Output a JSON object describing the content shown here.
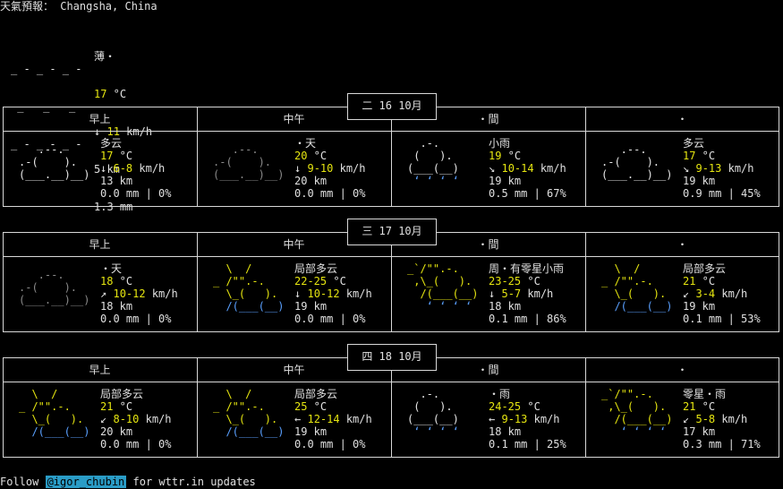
{
  "header": {
    "title": "天氣預報： Changsha, China"
  },
  "current": {
    "condition": "薄・",
    "temp": "17",
    "temp_unit": " °C",
    "wind_arrow": "↓",
    "wind_speed": "11",
    "wind_unit": " km/h",
    "visibility": "5 km",
    "precip": "1.3 mm",
    "art": [
      "_ - _ - _ -",
      " _ - _ - _",
      "_ - _ - _ -"
    ]
  },
  "days": [
    {
      "date": "二 16 10月",
      "periods": [
        {
          "title": "早上",
          "icon": "cloudy-icon",
          "icon_style": "art",
          "art": [
            "   .--.",
            ".-(    ).",
            "(___.__)__)"
          ],
          "condition": "多云",
          "temp": "17",
          "wind_arrow": "↓",
          "wind": "6-8",
          "visibility": "13 km",
          "precip": "0.0 mm | 0%"
        },
        {
          "title": "中午",
          "icon": "clear-icon",
          "icon_style": "gray",
          "art": [
            "   .--.",
            ".-(    ).",
            "(___.__)__)"
          ],
          "condition": "・天",
          "temp": "20",
          "wind_arrow": "↓",
          "wind": "9-10",
          "visibility": "20 km",
          "precip": "0.0 mm | 0%"
        },
        {
          "title": "・間",
          "icon": "light-rain-icon",
          "icon_style": "art",
          "art": [
            "  .-.",
            " (   ).",
            "(___(__)",
            " ‘ ‘ ‘ ‘"
          ],
          "condition": "小雨",
          "temp": "19",
          "wind_arrow": "↘",
          "wind": "10-14",
          "visibility": "19 km",
          "precip": "0.5 mm | 67%"
        },
        {
          "title": "・",
          "icon": "cloudy-icon",
          "icon_style": "art",
          "art": [
            "   .--.",
            ".-(    ).",
            "(___.__)__)"
          ],
          "condition": "多云",
          "temp": "17",
          "wind_arrow": "↘",
          "wind": "9-13",
          "visibility": "19 km",
          "precip": "0.9 mm | 45%"
        }
      ]
    },
    {
      "date": "三 17 10月",
      "periods": [
        {
          "title": "早上",
          "icon": "clear-icon",
          "icon_style": "gray",
          "art": [
            "   .--.",
            ".-(    ).",
            "(___.__)__)"
          ],
          "condition": "・天",
          "temp": "18",
          "wind_arrow": "↗",
          "wind": "10-12",
          "visibility": "18 km",
          "precip": "0.0 mm | 0%"
        },
        {
          "title": "中午",
          "icon": "partly-cloudy-icon",
          "icon_style": "sun",
          "art": [
            "  \\  /",
            "_ /\"\".-.",
            "  \\_(   ).",
            "  /(___(__)"
          ],
          "condition": "局部多云",
          "temp": "22-25",
          "wind_arrow": "↓",
          "wind": "10-12",
          "visibility": "19 km",
          "precip": "0.0 mm | 0%"
        },
        {
          "title": "・間",
          "icon": "patchy-rain-icon",
          "icon_style": "sun",
          "art": [
            "_`/\"\".-.",
            " ,\\_(   ).",
            "  /(___(__)",
            "   ‘ ‘ ‘ ‘"
          ],
          "condition": "周・有零星小雨",
          "temp": "23-25",
          "wind_arrow": "↓",
          "wind": "5-7",
          "visibility": "18 km",
          "precip": "0.1 mm | 86%"
        },
        {
          "title": "・",
          "icon": "partly-cloudy-icon",
          "icon_style": "sun",
          "art": [
            "  \\  /",
            "_ /\"\".-.",
            "  \\_(   ).",
            "  /(___(__)"
          ],
          "condition": "局部多云",
          "temp": "21",
          "wind_arrow": "↙",
          "wind": "3-4",
          "visibility": "19 km",
          "precip": "0.1 mm | 53%"
        }
      ]
    },
    {
      "date": "四 18 10月",
      "periods": [
        {
          "title": "早上",
          "icon": "partly-cloudy-icon",
          "icon_style": "sun",
          "art": [
            "  \\  /",
            "_ /\"\".-.",
            "  \\_(   ).",
            "  /(___(__)"
          ],
          "condition": "局部多云",
          "temp": "21",
          "wind_arrow": "↙",
          "wind": "8-10",
          "visibility": "20 km",
          "precip": "0.0 mm | 0%"
        },
        {
          "title": "中午",
          "icon": "partly-cloudy-icon",
          "icon_style": "sun",
          "art": [
            "  \\  /",
            "_ /\"\".-.",
            "  \\_(   ).",
            "  /(___(__)"
          ],
          "condition": "局部多云",
          "temp": "25",
          "wind_arrow": "←",
          "wind": "12-14",
          "visibility": "19 km",
          "precip": "0.0 mm | 0%"
        },
        {
          "title": "・間",
          "icon": "light-rain-icon",
          "icon_style": "art",
          "art": [
            "  .-.",
            " (   ).",
            "(___(__)",
            " ‘ ‘ ‘ ‘"
          ],
          "condition": "・雨",
          "temp": "24-25",
          "wind_arrow": "←",
          "wind": "9-13",
          "visibility": "18 km",
          "precip": "0.1 mm | 25%"
        },
        {
          "title": "・",
          "icon": "patchy-rain-icon",
          "icon_style": "sun",
          "art": [
            "_`/\"\".-.",
            " ,\\_(   ).",
            "  /(___(__)",
            "   ‘ ‘ ‘ ‘"
          ],
          "condition": "零星・雨",
          "temp": "21",
          "wind_arrow": "↙",
          "wind": "5-8",
          "visibility": "17 km",
          "precip": "0.3 mm | 71%"
        }
      ]
    }
  ],
  "units": {
    "temp": " °C",
    "wind": " km/h"
  },
  "footer": {
    "prefix": "Follow ",
    "handle": "@igor_chubin",
    "suffix": " for wttr.in updates"
  }
}
